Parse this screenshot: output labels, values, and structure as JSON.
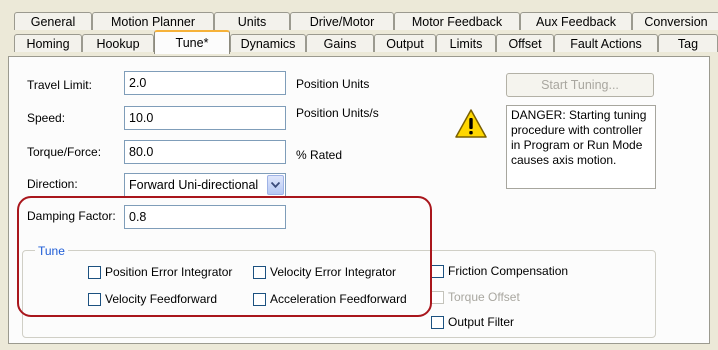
{
  "tabs_row1": [
    "General",
    "Motion Planner",
    "Units",
    "Drive/Motor",
    "Motor Feedback",
    "Aux Feedback",
    "Conversion"
  ],
  "tabs_row2": [
    "Homing",
    "Hookup",
    "Tune*",
    "Dynamics",
    "Gains",
    "Output",
    "Limits",
    "Offset",
    "Fault Actions",
    "Tag"
  ],
  "active_tab": "Tune*",
  "form": {
    "travel_limit": {
      "label": "Travel Limit:",
      "value": "2.0",
      "unit": "Position Units"
    },
    "speed": {
      "label": "Speed:",
      "value": "10.0",
      "unit": "Position Units/s"
    },
    "torque_force": {
      "label": "Torque/Force:",
      "value": "80.0",
      "unit": "% Rated"
    },
    "direction": {
      "label": "Direction:",
      "value": "Forward Uni-directional"
    },
    "damping_factor": {
      "label": "Damping Factor:",
      "value": "0.8"
    }
  },
  "start_tuning_button": "Start Tuning...",
  "warning": {
    "icon": "warning-triangle-icon",
    "text": "DANGER: Starting tuning procedure with controller in Program or Run Mode causes axis motion."
  },
  "tune_group": {
    "legend": "Tune",
    "options": {
      "position_error_integrator": {
        "label": "Position Error Integrator",
        "checked": false
      },
      "velocity_error_integrator": {
        "label": "Velocity Error Integrator",
        "checked": false
      },
      "velocity_feedforward": {
        "label": "Velocity Feedforward",
        "checked": false
      },
      "acceleration_feedforward": {
        "label": "Acceleration Feedforward",
        "checked": false
      },
      "friction_compensation": {
        "label": "Friction Compensation",
        "checked": false
      },
      "torque_offset": {
        "label": "Torque Offset",
        "checked": false,
        "disabled": true
      },
      "output_filter": {
        "label": "Output Filter",
        "checked": false
      }
    }
  },
  "colors": {
    "highlight": "#a9161c",
    "legend": "#1e5cd6",
    "active_tab_accent": "#f6b23a"
  }
}
